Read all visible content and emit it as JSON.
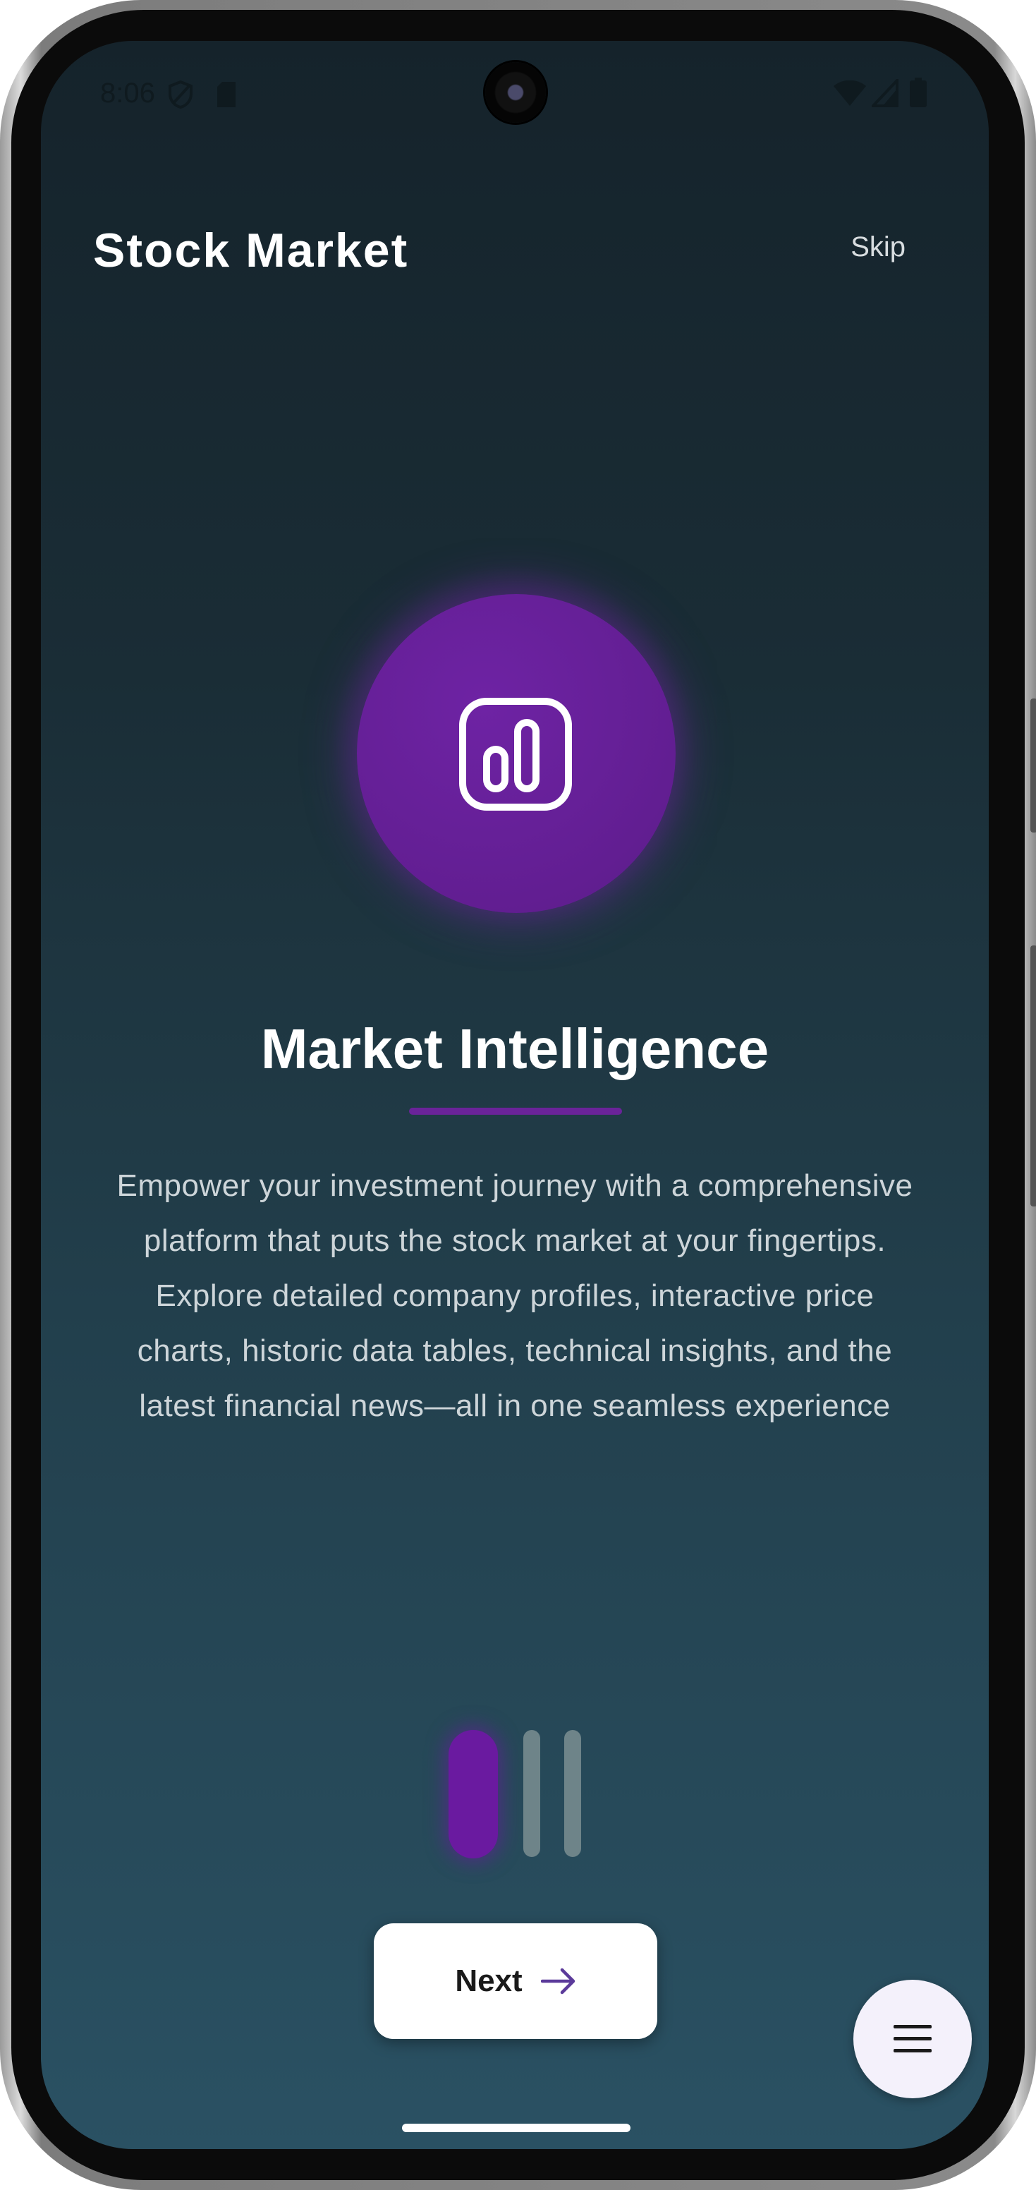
{
  "status_bar": {
    "time": "8:06",
    "icons": [
      "shield-icon",
      "sd-card-icon",
      "wifi-icon",
      "signal-icon",
      "battery-icon"
    ]
  },
  "header": {
    "title": "Stock Market",
    "skip_label": "Skip"
  },
  "hero": {
    "icon": "bar-chart-icon",
    "accent_color": "#6a1fa0"
  },
  "content": {
    "heading": "Market Intelligence",
    "description": "Empower your investment journey with a comprehensive platform that puts the stock market at your fingertips. Explore detailed company profiles, interactive price charts, historic data tables, technical insights, and the latest financial news—all in one seamless experience"
  },
  "pager": {
    "total_pages": 3,
    "current_page": 1
  },
  "actions": {
    "next_label": "Next",
    "next_icon": "arrow-right-icon",
    "menu_icon": "menu-icon"
  },
  "colors": {
    "accent": "#6a1fa0",
    "background_top": "#15232b",
    "background_bottom": "#2a5163",
    "button_bg": "#ffffff",
    "fab_bg": "#f4f1fb"
  }
}
